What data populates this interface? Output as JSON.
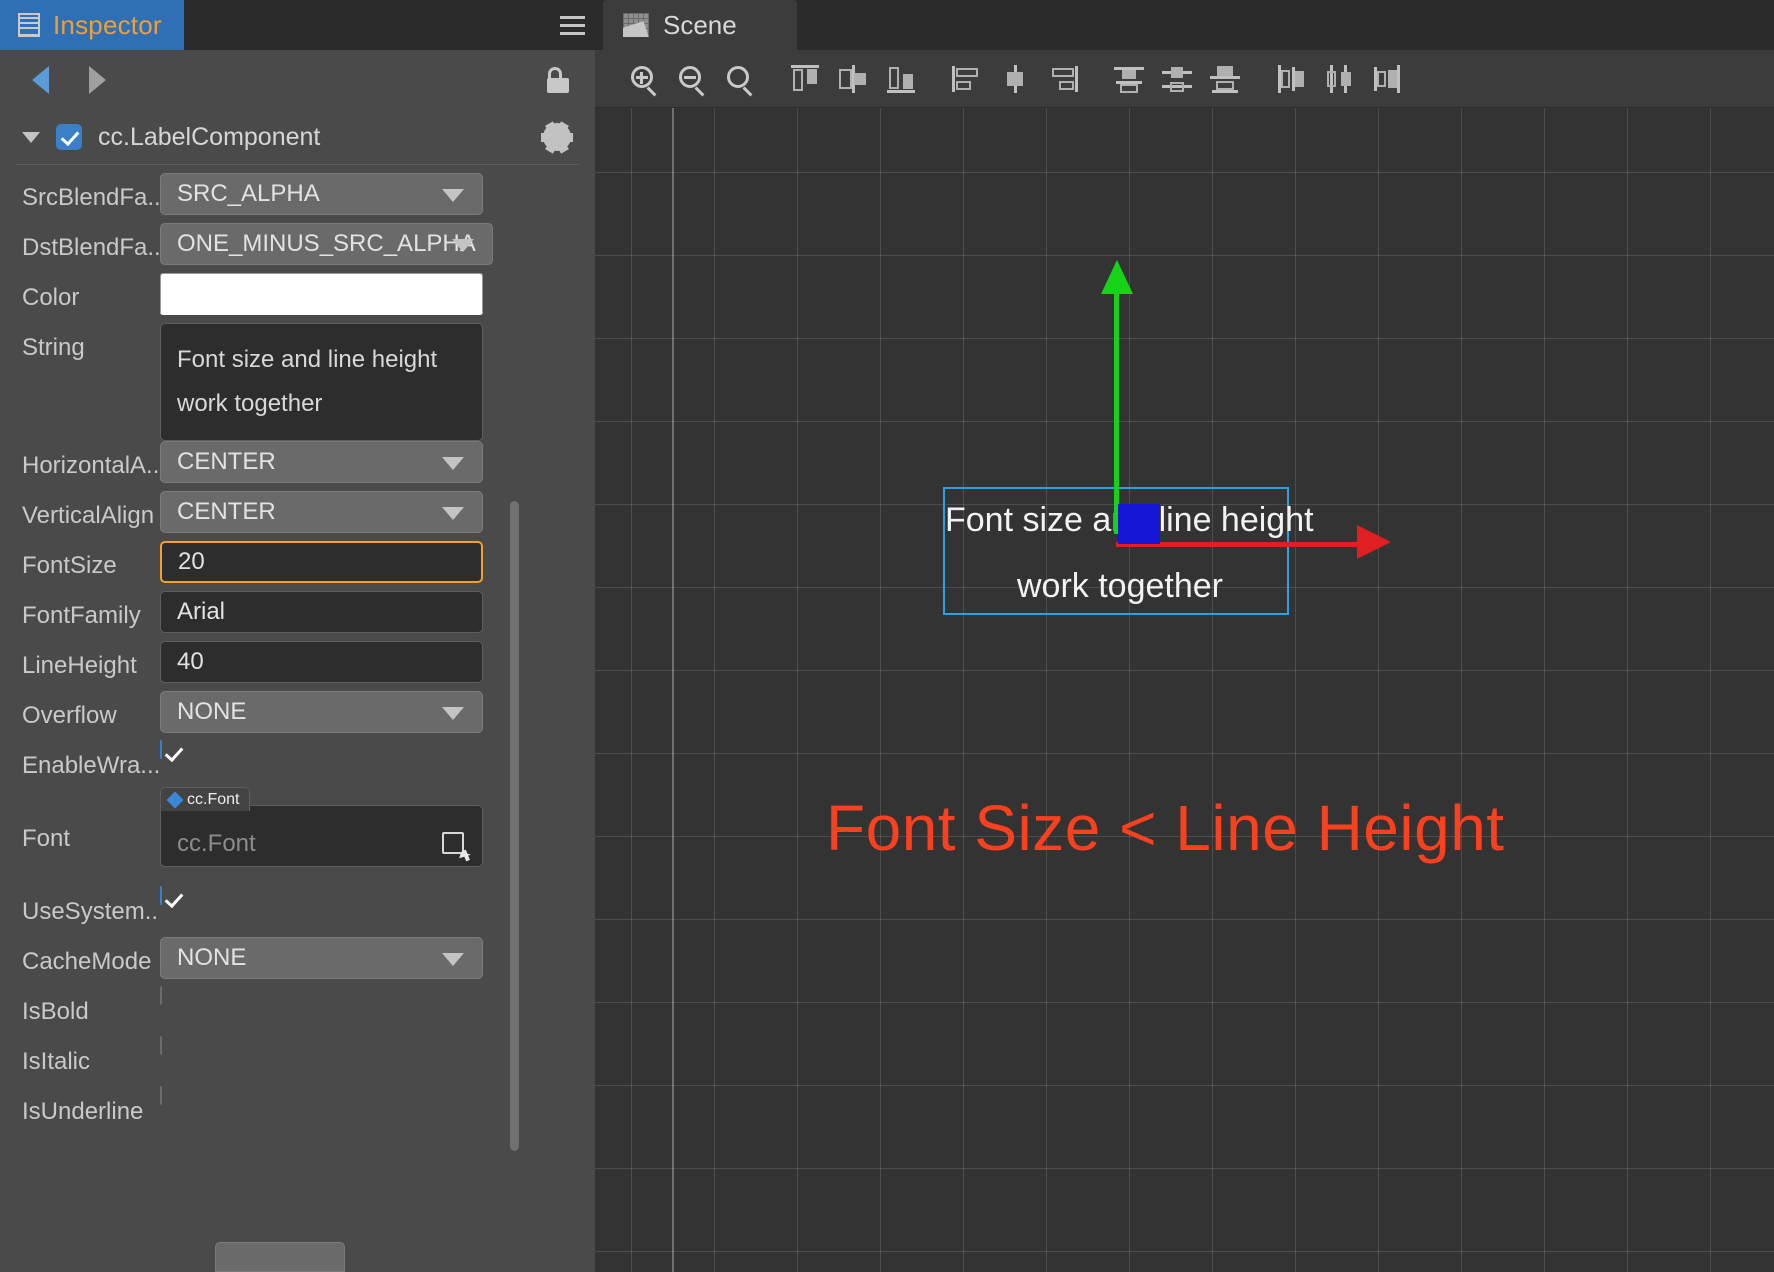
{
  "inspector": {
    "tab": {
      "label": "Inspector",
      "icon": "inspector-icon"
    },
    "menu_icon": "hamburger-menu-icon",
    "nav": {
      "back_icon": "back-arrow-icon",
      "forward_icon": "forward-arrow-icon",
      "lock_icon": "unlocked-padlock-icon"
    },
    "component": {
      "name": "cc.LabelComponent",
      "enabled": true,
      "expanded": true,
      "settings_icon": "gear-icon"
    },
    "properties": [
      {
        "label": "SrcBlendFa...",
        "full": "SrcBlendFactor",
        "type": "select",
        "value": "SRC_ALPHA"
      },
      {
        "label": "DstBlendFa...",
        "full": "DstBlendFactor",
        "type": "select",
        "value": "ONE_MINUS_SRC_ALPHA"
      },
      {
        "label": "Color",
        "type": "color",
        "value": "#FFFFFF"
      },
      {
        "label": "String",
        "type": "textarea",
        "value": "Font size and line height\nwork together",
        "line1": "Font size and line height",
        "line2": "work together"
      },
      {
        "label": "HorizontalA...",
        "full": "HorizontalAlign",
        "type": "select",
        "value": "CENTER"
      },
      {
        "label": "VerticalAlign",
        "type": "select",
        "value": "CENTER"
      },
      {
        "label": "FontSize",
        "type": "number",
        "value": "20",
        "focused": true
      },
      {
        "label": "FontFamily",
        "type": "text",
        "value": "Arial"
      },
      {
        "label": "LineHeight",
        "type": "number",
        "value": "40"
      },
      {
        "label": "Overflow",
        "type": "select",
        "value": "NONE"
      },
      {
        "label": "EnableWra...",
        "full": "EnableWrapText",
        "type": "checkbox",
        "checked": true
      },
      {
        "label": "Font",
        "type": "asset",
        "badge": "cc.Font",
        "value": "cc.Font",
        "pick_icon": "asset-picker-icon"
      },
      {
        "label": "UseSystem...",
        "full": "UseSystemFont",
        "type": "checkbox",
        "checked": true
      },
      {
        "label": "CacheMode",
        "type": "select",
        "value": "NONE"
      },
      {
        "label": "IsBold",
        "type": "checkbox",
        "checked": false
      },
      {
        "label": "IsItalic",
        "type": "checkbox",
        "checked": false
      },
      {
        "label": "IsUnderline",
        "type": "checkbox",
        "checked": false
      }
    ]
  },
  "scene": {
    "tab": {
      "label": "Scene",
      "icon": "scene-icon"
    },
    "toolbar": [
      {
        "name": "zoom-in-icon",
        "title": "Zoom In"
      },
      {
        "name": "zoom-out-icon",
        "title": "Zoom Out"
      },
      {
        "name": "zoom-fit-icon",
        "title": "Zoom Fit"
      },
      {
        "name": "align-top-icon",
        "title": "Align Top"
      },
      {
        "name": "align-vertical-center-icon",
        "title": "Align Vertical Center"
      },
      {
        "name": "align-bottom-icon",
        "title": "Align Bottom"
      },
      {
        "name": "align-left-icon",
        "title": "Align Left"
      },
      {
        "name": "align-horizontal-center-icon",
        "title": "Align Horizontal Center"
      },
      {
        "name": "align-right-icon",
        "title": "Align Right"
      },
      {
        "name": "distribute-top-icon",
        "title": "Distribute Top"
      },
      {
        "name": "distribute-vertical-center-icon",
        "title": "Distribute Vertical Center"
      },
      {
        "name": "distribute-bottom-icon",
        "title": "Distribute Bottom"
      },
      {
        "name": "distribute-left-icon",
        "title": "Distribute Left"
      },
      {
        "name": "distribute-horizontal-center-icon",
        "title": "Distribute Horizontal Center"
      },
      {
        "name": "distribute-right-icon",
        "title": "Distribute Right"
      }
    ],
    "node": {
      "line1": "Font size and line height",
      "line2": "work together",
      "selection_color": "#2AA2E0"
    },
    "gizmo": {
      "y_axis_color": "#17D317",
      "x_axis_color": "#E02020",
      "origin_color": "#1616D8"
    },
    "annotation": {
      "text": "Font Size < Line Height",
      "color": "#F9401F"
    }
  }
}
